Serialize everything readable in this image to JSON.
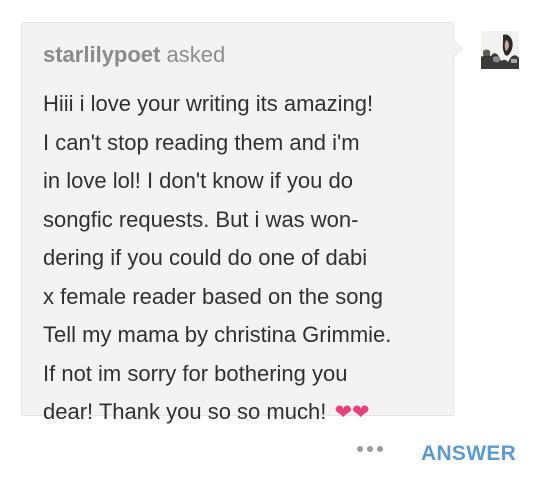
{
  "asker": {
    "username": "starlilypoet",
    "action": "asked"
  },
  "question": {
    "lines": [
      "Hiii i love your writing its amazing!",
      "I can't stop reading them and i'm",
      "in love lol! I don't know if you do",
      "songfic requests. But i was won-",
      "dering if you could do one of dabi",
      "x female reader based on the song",
      "Tell my mama by christina Grimmie.",
      "If not im sorry for bothering you",
      "dear! Thank you so so much!"
    ],
    "emoji": "❤❤"
  },
  "actions": {
    "more_icon": "ellipsis-icon",
    "answer_label": "ANSWER"
  },
  "colors": {
    "bubble_background": "#f3f3f3",
    "question_text": "#303030",
    "asker_text": "#8e8e8e",
    "answer_accent": "#5b9bd0",
    "heart": "#e8407a"
  }
}
